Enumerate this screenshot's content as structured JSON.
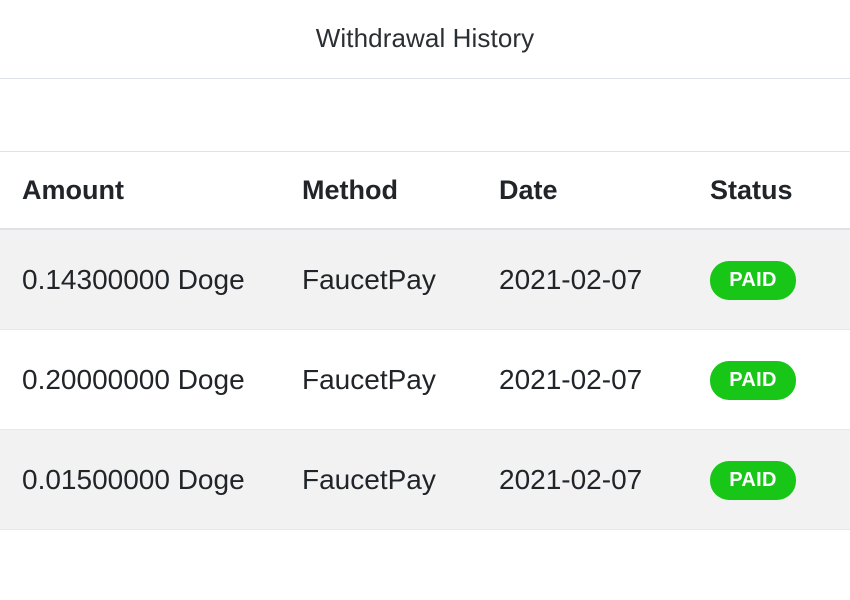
{
  "card": {
    "title": "Withdrawal History"
  },
  "toolbar": {
    "content": ""
  },
  "table": {
    "columns": [
      {
        "key": "amount",
        "label": "Amount"
      },
      {
        "key": "method",
        "label": "Method"
      },
      {
        "key": "date",
        "label": "Date"
      },
      {
        "key": "status",
        "label": "Status"
      }
    ],
    "rows": [
      {
        "amount": "0.14300000 Doge",
        "method": "FaucetPay",
        "date": "2021-02-07",
        "status": "PAID"
      },
      {
        "amount": "0.20000000 Doge",
        "method": "FaucetPay",
        "date": "2021-02-07",
        "status": "PAID"
      },
      {
        "amount": "0.01500000 Doge",
        "method": "FaucetPay",
        "date": "2021-02-07",
        "status": "PAID"
      }
    ]
  },
  "colors": {
    "badge_paid_bg": "#17c617",
    "badge_paid_text": "#ffffff",
    "row_stripe": "#f2f2f2",
    "row_plain": "#ffffff",
    "divider": "#dee2e6",
    "text": "#212529"
  }
}
